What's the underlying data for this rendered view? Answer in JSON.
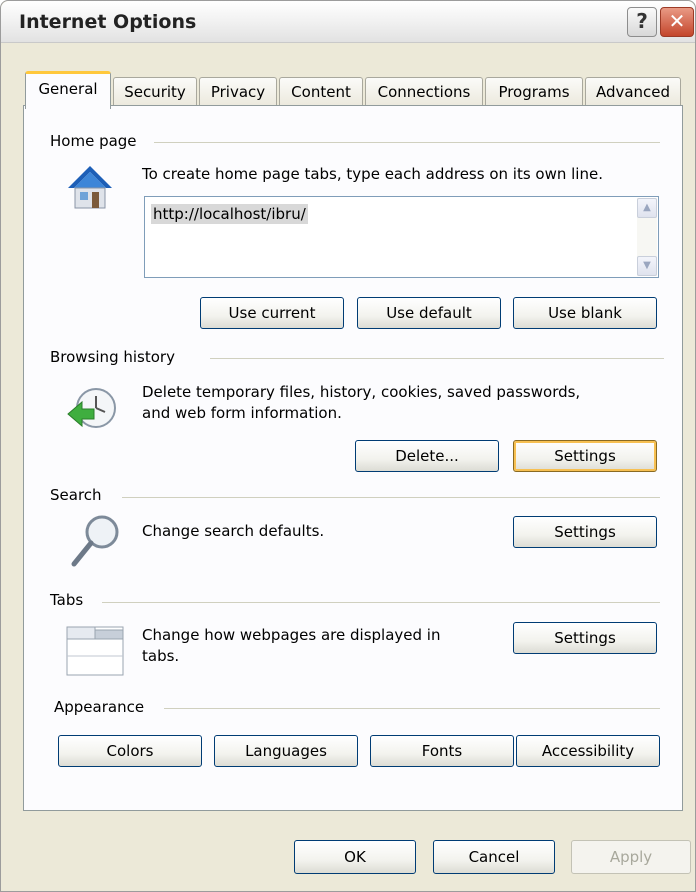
{
  "window": {
    "title": "Internet Options",
    "help_label": "?",
    "close_label": "✕"
  },
  "tabs": [
    {
      "label": "General",
      "active": true
    },
    {
      "label": "Security"
    },
    {
      "label": "Privacy"
    },
    {
      "label": "Content"
    },
    {
      "label": "Connections"
    },
    {
      "label": "Programs"
    },
    {
      "label": "Advanced"
    }
  ],
  "home_page": {
    "heading": "Home page",
    "description": "To create home page tabs, type each address on its own line.",
    "url_value": "http://localhost/ibru/",
    "buttons": {
      "use_current": "Use current",
      "use_default": "Use default",
      "use_blank": "Use blank"
    }
  },
  "browsing_history": {
    "heading": "Browsing history",
    "description_line1": "Delete temporary files, history, cookies, saved passwords,",
    "description_line2": "and web form information.",
    "delete_label": "Delete...",
    "settings_label": "Settings"
  },
  "search": {
    "heading": "Search",
    "description": "Change search defaults.",
    "settings_label": "Settings"
  },
  "tabs_section": {
    "heading": "Tabs",
    "description_line1": "Change how webpages are displayed in",
    "description_line2": "tabs.",
    "settings_label": "Settings"
  },
  "appearance": {
    "heading": "Appearance",
    "colors_label": "Colors",
    "languages_label": "Languages",
    "fonts_label": "Fonts",
    "accessibility_label": "Accessibility"
  },
  "footer": {
    "ok_label": "OK",
    "cancel_label": "Cancel",
    "apply_label": "Apply"
  },
  "colors": {
    "active_tab_accent": "#ffc83c",
    "button_border": "#003c74",
    "dialog_bg": "#ece9d8"
  }
}
